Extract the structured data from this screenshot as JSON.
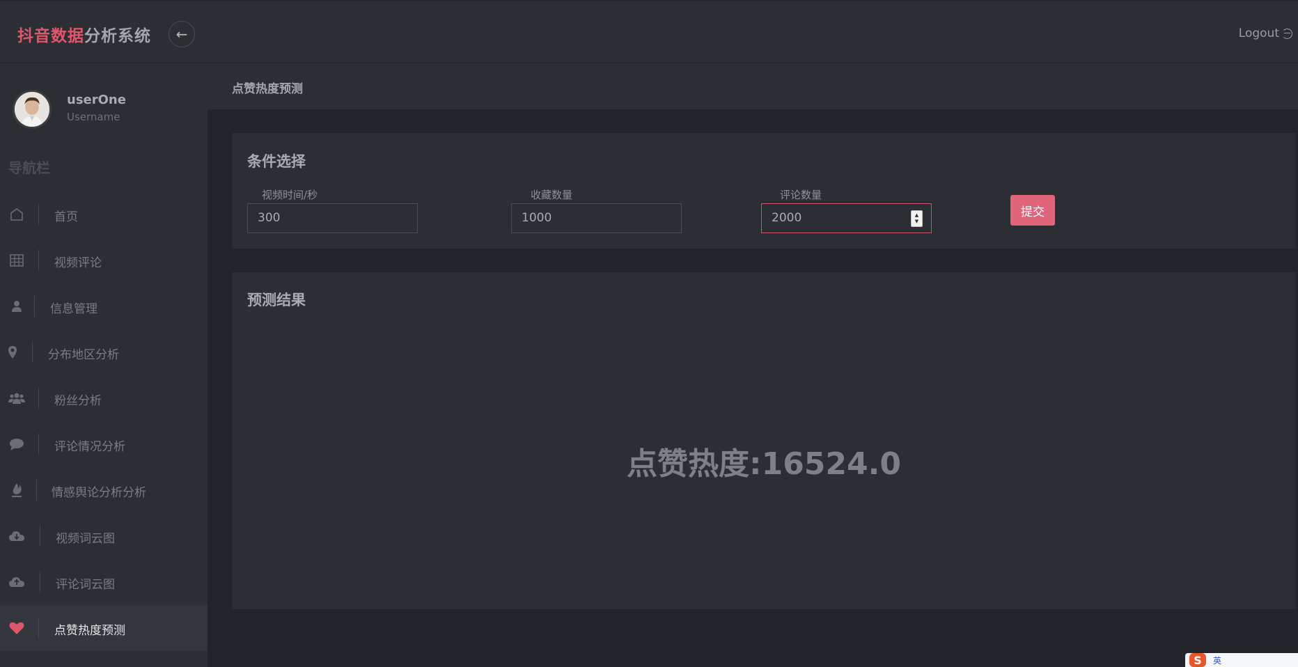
{
  "header": {
    "brand_accent": "抖音数据",
    "brand_rest": "分析系统",
    "back_icon": "←",
    "logout_label": "Logout"
  },
  "user": {
    "name": "userOne",
    "role": "Username"
  },
  "sidebar": {
    "heading": "导航栏",
    "items": [
      {
        "label": "首页",
        "icon": "home-icon"
      },
      {
        "label": "视频评论",
        "icon": "grid-icon"
      },
      {
        "label": "信息管理",
        "icon": "user-icon"
      },
      {
        "label": "分布地区分析",
        "icon": "map-pin-icon"
      },
      {
        "label": "粉丝分析",
        "icon": "users-icon"
      },
      {
        "label": "评论情况分析",
        "icon": "chat-bubble-icon"
      },
      {
        "label": "情感舆论分析分析",
        "icon": "fire-icon"
      },
      {
        "label": "视频词云图",
        "icon": "cloud-download-icon"
      },
      {
        "label": "评论词云图",
        "icon": "cloud-upload-icon"
      },
      {
        "label": "点赞热度预测",
        "icon": "heart-icon",
        "active": true
      }
    ]
  },
  "breadcrumb": "点赞热度预测",
  "conditions": {
    "title": "条件选择",
    "fields": [
      {
        "label": "视频时间/秒",
        "value": "300"
      },
      {
        "label": "收藏数量",
        "value": "1000"
      },
      {
        "label": "评论数量",
        "value": "2000"
      }
    ],
    "submit_label": "提交"
  },
  "result": {
    "title": "预测结果",
    "text": "点赞热度:16524.0"
  },
  "ime": {
    "logo": "S",
    "mode": "英"
  },
  "colors": {
    "accent": "#e0566c",
    "button": "#e0647a",
    "background": "#222429",
    "panel": "#2b2e33"
  }
}
